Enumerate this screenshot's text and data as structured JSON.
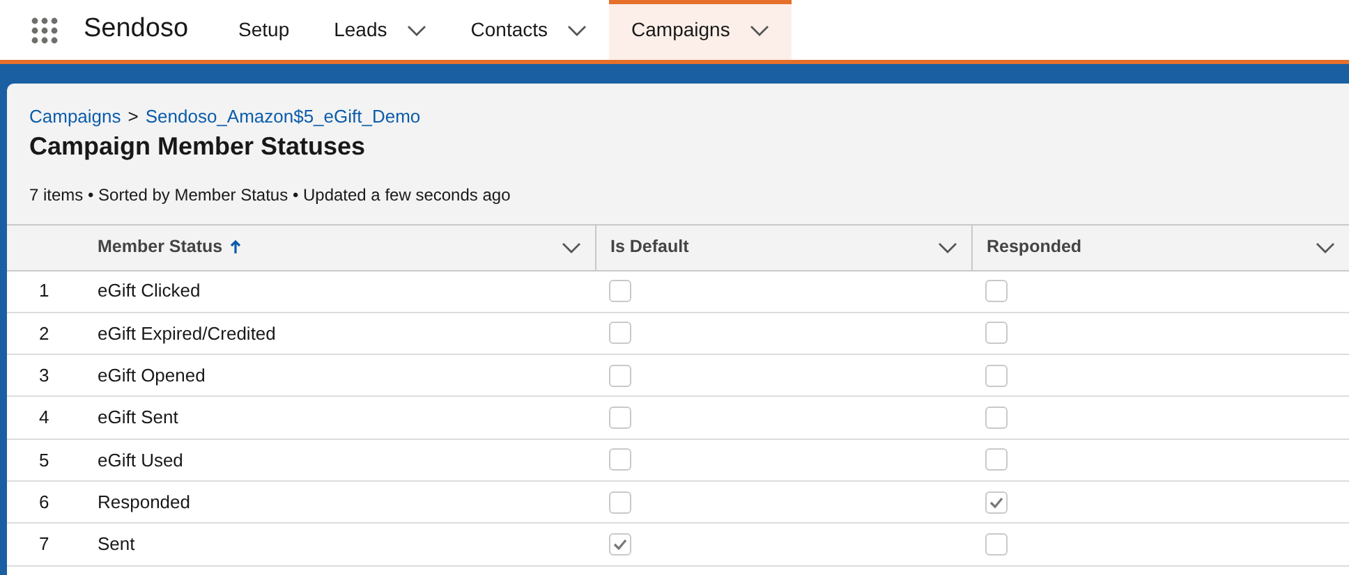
{
  "app_name": "Sendoso",
  "nav_tabs": [
    {
      "label": "Setup",
      "has_menu": false,
      "selected": false
    },
    {
      "label": "Leads",
      "has_menu": true,
      "selected": false
    },
    {
      "label": "Contacts",
      "has_menu": true,
      "selected": false
    },
    {
      "label": "Campaigns",
      "has_menu": true,
      "selected": true
    }
  ],
  "breadcrumb": {
    "parent": "Campaigns",
    "separator": ">",
    "current": "Sendoso_Amazon$5_eGift_Demo"
  },
  "title": "Campaign Member Statuses",
  "summary": "7 items • Sorted by Member Status • Updated a few seconds ago",
  "table": {
    "columns": [
      {
        "label": "Member Status",
        "sorted": true
      },
      {
        "label": "Is Default",
        "sorted": false
      },
      {
        "label": "Responded",
        "sorted": false
      }
    ],
    "rows": [
      {
        "number": "1",
        "status": "eGift Clicked",
        "is_default": false,
        "responded": false
      },
      {
        "number": "2",
        "status": "eGift Expired/Credited",
        "is_default": false,
        "responded": false
      },
      {
        "number": "3",
        "status": "eGift Opened",
        "is_default": false,
        "responded": false
      },
      {
        "number": "4",
        "status": "eGift Sent",
        "is_default": false,
        "responded": false
      },
      {
        "number": "5",
        "status": "eGift Used",
        "is_default": false,
        "responded": false
      },
      {
        "number": "6",
        "status": "Responded",
        "is_default": false,
        "responded": true
      },
      {
        "number": "7",
        "status": "Sent",
        "is_default": true,
        "responded": false
      }
    ]
  }
}
